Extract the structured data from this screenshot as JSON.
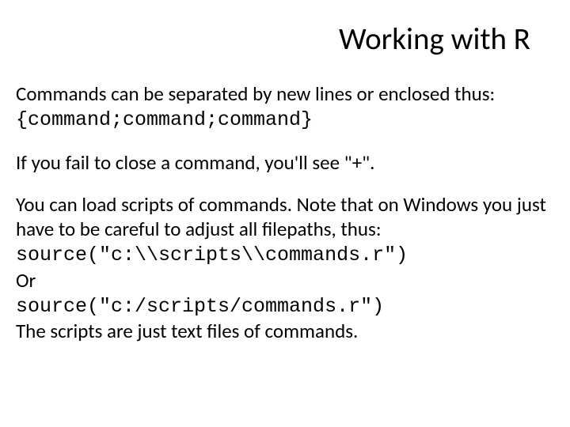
{
  "title": "Working with R",
  "p1_line1": "Commands can be separated by new lines or enclosed thus:",
  "p1_code": "{command;command;command}",
  "p2": "If you fail to close a command, you'll see \"+\".",
  "p3_line1": "You can load scripts of commands. Note that on Windows you just have to be careful to adjust all filepaths, thus:",
  "p3_code1": "source(\"c:\\\\scripts\\\\commands.r\")",
  "p3_or": "Or",
  "p3_code2": "source(\"c:/scripts/commands.r\")",
  "p3_line2": "The scripts are just text files of commands."
}
